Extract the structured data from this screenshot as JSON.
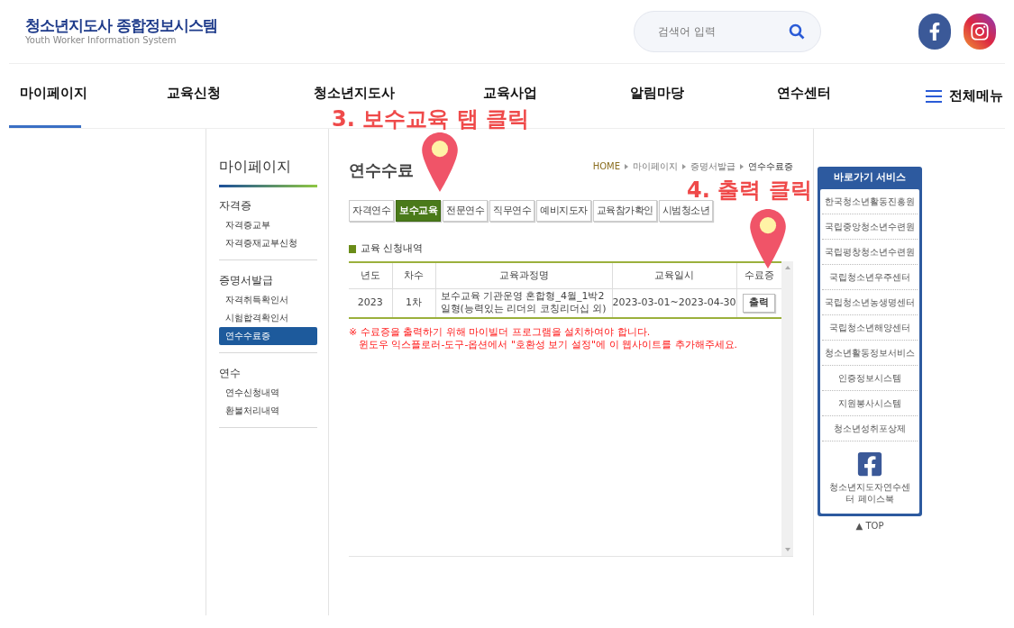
{
  "header": {
    "logo_title": "청소년지도사 종합정보시스템",
    "logo_subtitle": "Youth Worker Information System",
    "search": {
      "placeholder": "검색어 입력"
    }
  },
  "nav": {
    "items": [
      {
        "label": "마이페이지",
        "selected": true
      },
      {
        "label": "교육신청",
        "selected": false
      },
      {
        "label": "청소년지도사",
        "selected": false
      },
      {
        "label": "교육사업",
        "selected": false
      },
      {
        "label": "알림마당",
        "selected": false
      },
      {
        "label": "연수센터",
        "selected": false
      }
    ],
    "all_menu": "전체메뉴"
  },
  "sidebar": {
    "title": "마이페이지",
    "groups": [
      {
        "label": "자격증",
        "items": [
          {
            "label": "자격증교부",
            "selected": false
          },
          {
            "label": "자격증재교부신청",
            "selected": false
          }
        ]
      },
      {
        "label": "증명서발급",
        "items": [
          {
            "label": "자격취득확인서",
            "selected": false
          },
          {
            "label": "시험합격확인서",
            "selected": false
          },
          {
            "label": "연수수료증",
            "selected": true
          }
        ]
      },
      {
        "label": "연수",
        "items": [
          {
            "label": "연수신청내역",
            "selected": false
          },
          {
            "label": "환불처리내역",
            "selected": false
          }
        ]
      }
    ]
  },
  "main": {
    "title": "연수수료",
    "breadcrumb": [
      "HOME",
      "마이페이지",
      "증명서발급",
      "연수수료증"
    ],
    "tabs": [
      {
        "label": "자격연수",
        "selected": false
      },
      {
        "label": "보수교육",
        "selected": true
      },
      {
        "label": "전문연수",
        "selected": false
      },
      {
        "label": "직무연수",
        "selected": false
      },
      {
        "label": "예비지도자",
        "selected": false
      },
      {
        "label": "교육참가확인",
        "selected": false
      },
      {
        "label": "시범청소년",
        "selected": false
      }
    ],
    "section_title": "교육 신청내역",
    "table": {
      "columns": [
        "년도",
        "차수",
        "교육과정명",
        "교육일시",
        "수료증"
      ],
      "rows": [
        {
          "year": "2023",
          "round": "1차",
          "course": "보수교육 기관운영 혼합형_4월_1박2일형(능력있는 리더의 코칭리더십 외)",
          "period": "2023-03-01~2023-04-30",
          "action": "출력"
        }
      ]
    },
    "notes": [
      "※ 수료증을 출력하기 위해 마이빌더 프로그램을 설치하여야 합니다.",
      "윈도우 익스플로러-도구-옵션에서 \"호환성 보기 설정\"에 이 웹사이트를 추가해주세요."
    ]
  },
  "quick_menu": {
    "title": "바로가기 서비스",
    "items": [
      "한국청소년활동진흥원",
      "국립중앙청소년수련원",
      "국립평창청소년수련원",
      "국립청소년우주센터",
      "국립청소년농생명센터",
      "국립청소년해양센터",
      "청소년활동정보서비스",
      "인증정보시스템",
      "지원봉사시스템",
      "청소년성취포상제"
    ],
    "facebook_label": "청소년지도자연수센터 페이스북",
    "top": "▲ TOP"
  },
  "annotations": [
    {
      "text": "3. 보수교육 탭 클릭"
    },
    {
      "text": "4. 출력 클릭"
    }
  ]
}
